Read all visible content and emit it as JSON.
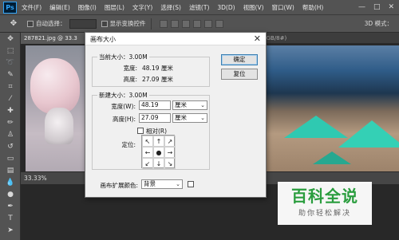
{
  "app": {
    "logo": "Ps",
    "menu": [
      "文件(F)",
      "编辑(E)",
      "图像(I)",
      "图层(L)",
      "文字(Y)",
      "选择(S)",
      "滤镜(T)",
      "3D(D)",
      "视图(V)",
      "窗口(W)",
      "帮助(H)"
    ],
    "window_controls": [
      "—",
      "□",
      "✕"
    ]
  },
  "options_bar": {
    "auto_select_label": "自动选择：",
    "show_transform_label": "显示变换控件",
    "mode_3d_label": "3D 模式："
  },
  "document": {
    "tab_title": "287821.jpg @ 33.3",
    "tab_close": "×",
    "right_tab": "(RGB/8#)",
    "zoom": "33.33%"
  },
  "dialog": {
    "title": "画布大小",
    "close": "✕",
    "current_size": {
      "label": "当前大小：3.00M",
      "width_label": "宽度:",
      "width_value": "48.19 厘米",
      "height_label": "高度:",
      "height_value": "27.09 厘米"
    },
    "new_size": {
      "label": "新建大小：3.00M",
      "width_label": "宽度(W):",
      "width_value": "48.19",
      "width_unit": "厘米",
      "height_label": "高度(H):",
      "height_value": "27.09",
      "height_unit": "厘米",
      "relative_label": "相对(R)",
      "anchor_label": "定位:"
    },
    "extension_color": {
      "label": "画布扩展颜色:",
      "value": "背景"
    },
    "ok_button": "确定",
    "reset_button": "复位"
  },
  "anchor_arrows": [
    "↖",
    "↑",
    "↗",
    "←",
    "●",
    "→",
    "↙",
    "↓",
    "↘"
  ],
  "watermark": {
    "title": "百科全说",
    "subtitle": "助你轻松解决"
  }
}
